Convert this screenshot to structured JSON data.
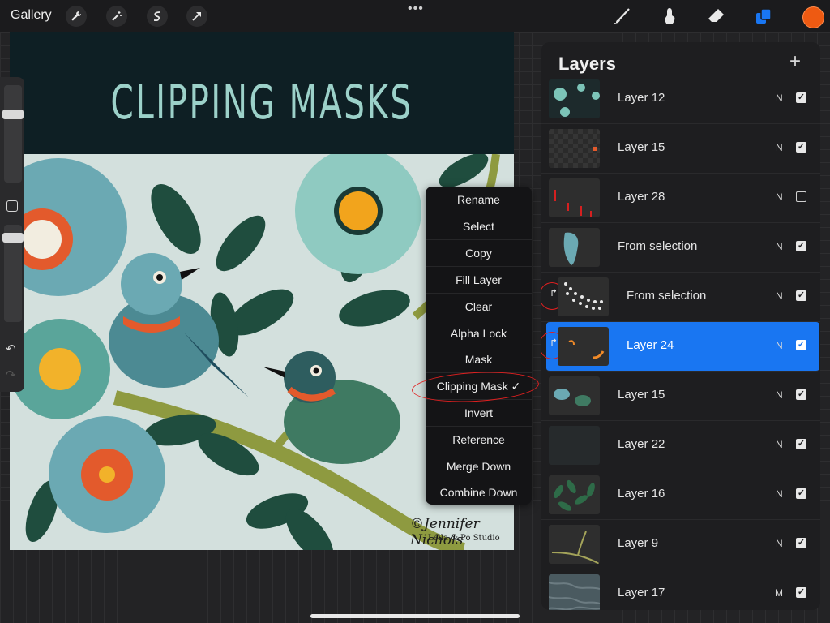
{
  "topbar": {
    "gallery_label": "Gallery",
    "more_label": "•••",
    "left_tools": [
      "wrench-icon",
      "magic-wand-icon",
      "selection-icon",
      "transform-icon"
    ],
    "right_tools": [
      "brush-icon",
      "smudge-icon",
      "eraser-icon",
      "layers-icon"
    ],
    "current_color": "#ee5a12",
    "accent": "#1976f2"
  },
  "canvas": {
    "title": "CLIPPING MASKS",
    "signature": "©Jennifer Nichols",
    "studio": "Leila & Po Studio"
  },
  "context_menu": {
    "items": [
      "Rename",
      "Select",
      "Copy",
      "Fill Layer",
      "Clear",
      "Alpha Lock",
      "Mask",
      "Clipping Mask ✓",
      "Invert",
      "Reference",
      "Merge Down",
      "Combine Down"
    ]
  },
  "layers_panel": {
    "title": "Layers",
    "add_label": "+",
    "layers": [
      {
        "name": "Layer 12",
        "blend": "N",
        "visible": true
      },
      {
        "name": "Layer 15",
        "blend": "N",
        "visible": true
      },
      {
        "name": "Layer 28",
        "blend": "N",
        "visible": false
      },
      {
        "name": "From selection",
        "blend": "N",
        "visible": true
      },
      {
        "name": "From selection",
        "blend": "N",
        "visible": true,
        "clipped": true
      },
      {
        "name": "Layer 24",
        "blend": "N",
        "visible": true,
        "clipped": true,
        "selected": true
      },
      {
        "name": "Layer 15",
        "blend": "N",
        "visible": true
      },
      {
        "name": "Layer 22",
        "blend": "N",
        "visible": true
      },
      {
        "name": "Layer 16",
        "blend": "N",
        "visible": true
      },
      {
        "name": "Layer 9",
        "blend": "N",
        "visible": true
      },
      {
        "name": "Layer 17",
        "blend": "M",
        "visible": true
      }
    ]
  }
}
